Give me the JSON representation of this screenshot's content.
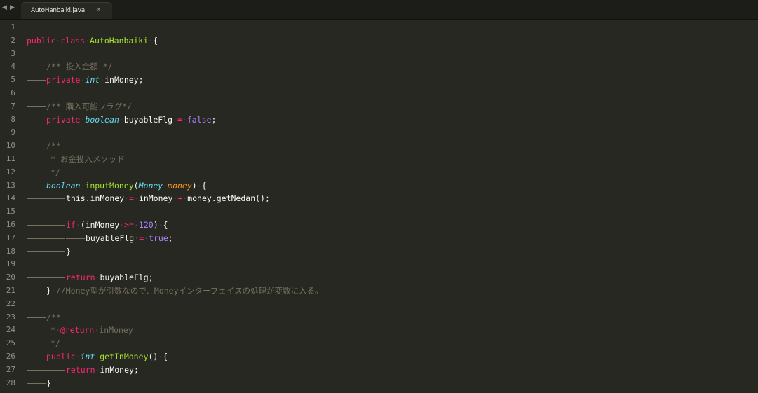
{
  "tabbar": {
    "back_arrow": "◀",
    "forward_arrow": "▶",
    "tab_title": "AutoHanbaiki.java",
    "tab_close": "×"
  },
  "colors": {
    "background": "#272822",
    "keyword": "#f92672",
    "class": "#a6e22e",
    "type": "#66d9ef",
    "param": "#fd971f",
    "number": "#ae81ff",
    "comment": "#75715e"
  },
  "lines": [
    {
      "n": "1"
    },
    {
      "n": "2"
    },
    {
      "n": "3"
    },
    {
      "n": "4"
    },
    {
      "n": "5"
    },
    {
      "n": "6"
    },
    {
      "n": "7"
    },
    {
      "n": "8"
    },
    {
      "n": "9"
    },
    {
      "n": "10"
    },
    {
      "n": "11"
    },
    {
      "n": "12"
    },
    {
      "n": "13"
    },
    {
      "n": "14"
    },
    {
      "n": "15"
    },
    {
      "n": "16"
    },
    {
      "n": "17"
    },
    {
      "n": "18"
    },
    {
      "n": "19"
    },
    {
      "n": "20"
    },
    {
      "n": "21"
    },
    {
      "n": "22"
    },
    {
      "n": "23"
    },
    {
      "n": "24"
    },
    {
      "n": "25"
    },
    {
      "n": "26"
    },
    {
      "n": "27"
    },
    {
      "n": "28"
    }
  ],
  "code": {
    "l2": {
      "kw1": "public",
      "kw2": "class",
      "name": "AutoHanbaiki",
      "brace": "{"
    },
    "l4": {
      "comment": "/** 投入金額 */"
    },
    "l5": {
      "kw": "private",
      "type": "int",
      "rest": "inMoney;"
    },
    "l7": {
      "comment": "/** 購入可能フラグ*/"
    },
    "l8": {
      "kw": "private",
      "type": "boolean",
      "var": "buyableFlg",
      "op": "=",
      "val": "false",
      "end": ";"
    },
    "l10": {
      "comment": "/**"
    },
    "l11": {
      "comment": "* お金投入メソッド"
    },
    "l12": {
      "comment": "*/"
    },
    "l13": {
      "type": "boolean",
      "fn": "inputMoney",
      "open": "(",
      "ptype": "Money",
      "pname": "money",
      "close": ")",
      "brace": "{"
    },
    "l14": {
      "kw": "this",
      "a": ".inMoney",
      "op": "=",
      "b": "inMoney",
      "op2": "+",
      "c": "money.getNedan();"
    },
    "l16": {
      "kw": "if",
      "a": "(inMoney",
      "op": ">=",
      "num": "120",
      "b": ")",
      "brace": "{"
    },
    "l17": {
      "a": "buyableFlg",
      "op": "=",
      "val": "true",
      "end": ";"
    },
    "l18": {
      "brace": "}"
    },
    "l20": {
      "kw": "return",
      "rest": "buyableFlg;"
    },
    "l21": {
      "brace": "}",
      "comment": "//Money型が引数なので、Moneyインターフェイスの処理が変数に入る。"
    },
    "l23": {
      "comment": "/**"
    },
    "l24": {
      "star": "*",
      "tag": "@return",
      "text": "inMoney"
    },
    "l25": {
      "comment": "*/"
    },
    "l26": {
      "kw": "public",
      "type": "int",
      "fn": "getInMoney",
      "parens": "()",
      "brace": "{"
    },
    "l27": {
      "kw": "return",
      "rest": "inMoney;"
    },
    "l28": {
      "brace": "}"
    }
  }
}
